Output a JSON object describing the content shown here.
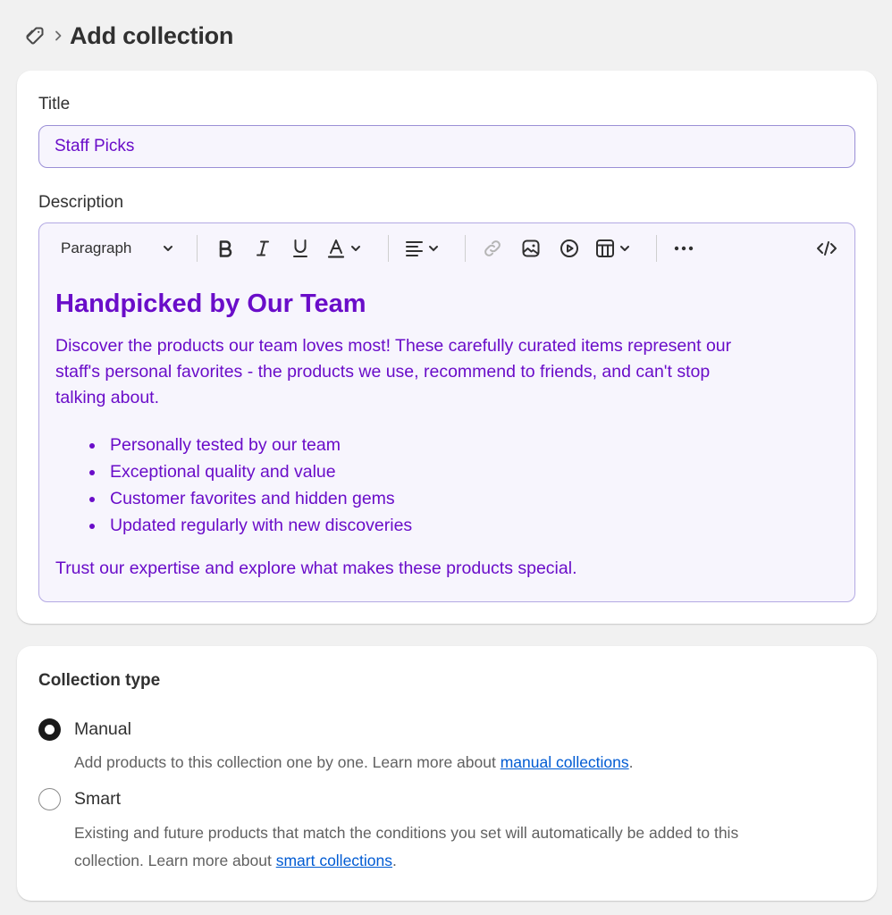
{
  "header": {
    "icon": "tag-icon",
    "title": "Add collection"
  },
  "form": {
    "title_label": "Title",
    "title_value": "Staff Picks",
    "description_label": "Description"
  },
  "toolbar": {
    "paragraph_style": "Paragraph",
    "icons": [
      "bold-icon",
      "italic-icon",
      "underline-icon",
      "text-color-icon",
      "align-icon",
      "link-icon",
      "image-icon",
      "video-icon",
      "table-icon",
      "more-icon",
      "code-icon"
    ]
  },
  "description": {
    "heading": "Handpicked by Our Team",
    "intro_line1": "Discover the products our team loves most! These carefully curated items represent our",
    "intro_line2": "staff's personal favorites - the products we use, recommend to friends, and can't stop",
    "intro_line3": "talking about.",
    "bullets": [
      "Personally tested by our team",
      "Exceptional quality and value",
      "Customer favorites and hidden gems",
      "Updated regularly with new discoveries"
    ],
    "closing": "Trust our expertise and explore what makes these products special."
  },
  "collection_type": {
    "title": "Collection type",
    "manual": {
      "label": "Manual",
      "selected": true,
      "help_text": "Add products to this collection one by one. Learn more about ",
      "link": "manual collections",
      "suffix": "."
    },
    "smart": {
      "label": "Smart",
      "selected": false,
      "help_line1": "Existing and future products that match the conditions you set will automatically be added to this",
      "help_line2": "collection. Learn more about ",
      "link": "smart collections",
      "suffix": "."
    }
  },
  "colors": {
    "accent_text": "#6a0dc9",
    "link": "#005bd3",
    "input_border": "#9a8fd6",
    "input_bg": "#f7f5fd"
  }
}
